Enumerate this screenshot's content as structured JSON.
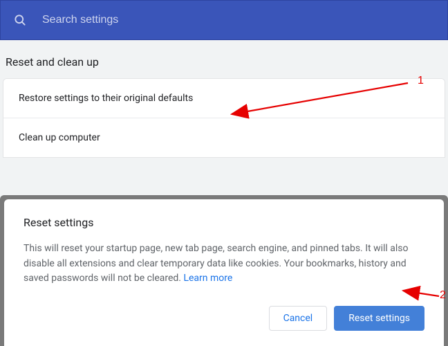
{
  "search": {
    "placeholder": "Search settings"
  },
  "section": {
    "title": "Reset and clean up",
    "rows": {
      "restore": "Restore settings to their original defaults",
      "cleanup": "Clean up computer"
    }
  },
  "dialog": {
    "title": "Reset settings",
    "body": "This will reset your startup page, new tab page, search engine, and pinned tabs. It will also disable all extensions and clear temporary data like cookies. Your bookmarks, history and saved passwords will not be cleared. ",
    "learn_more": "Learn more",
    "cancel": "Cancel",
    "confirm": "Reset settings"
  },
  "annotations": {
    "one": "1",
    "two": "2"
  }
}
